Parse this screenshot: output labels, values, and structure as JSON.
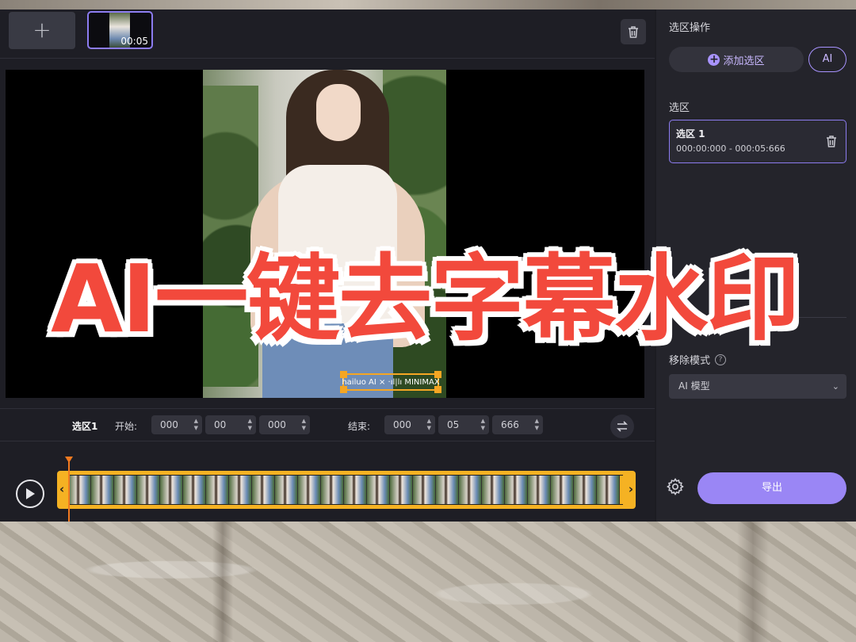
{
  "overlay": {
    "headline": "AI一键去字幕水印"
  },
  "toolbar": {
    "add_label": "+",
    "clip_duration": "00:05"
  },
  "video": {
    "watermark_text": "hailuo AI × ·ıl|lı MINIMAX"
  },
  "time_editor": {
    "selection_name": "选区1",
    "start_label": "开始:",
    "start_values": [
      "000",
      "00",
      "000"
    ],
    "end_label": "结束:",
    "end_values": [
      "000",
      "05",
      "666"
    ]
  },
  "right_panel": {
    "section_title": "选区操作",
    "add_selection_label": "添加选区",
    "ai_label": "AI",
    "selections_title": "选区",
    "selections": [
      {
        "name": "选区 1",
        "range": "000:00:000 - 000:05:666"
      }
    ],
    "removal_mode_label": "移除模式",
    "removal_mode_value": "AI 模型",
    "export_label": "导出"
  },
  "colors": {
    "accent": "#9a86f5",
    "track": "#f5b223",
    "headline": "#f2493c"
  },
  "icons": [
    "plus-icon",
    "trash-icon",
    "swap-icon",
    "play-icon",
    "help-icon",
    "chevron-down-icon",
    "gear-icon"
  ]
}
